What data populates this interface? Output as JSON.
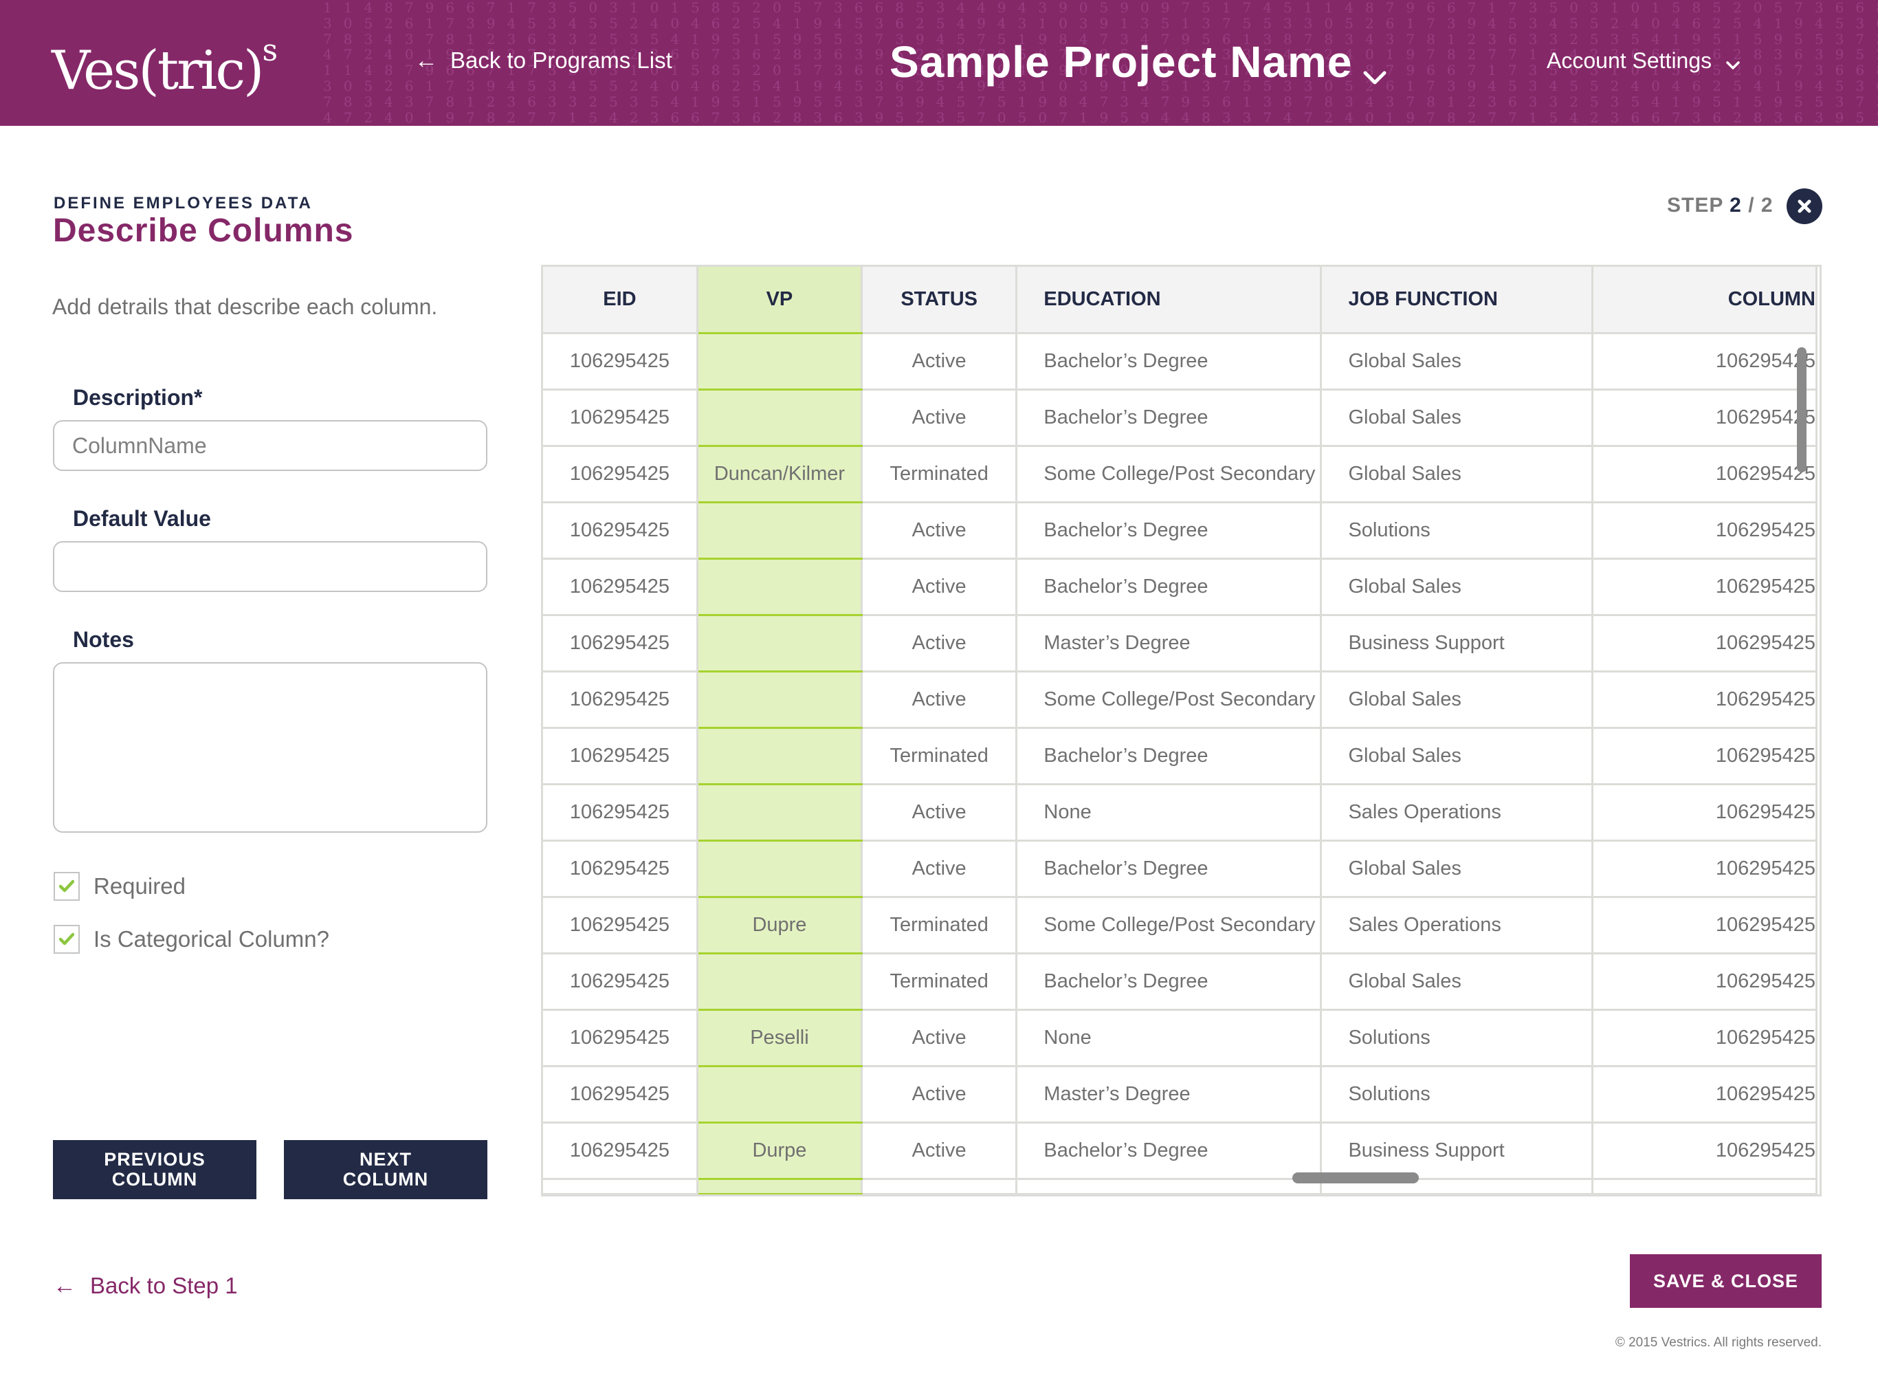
{
  "header": {
    "logo": {
      "main": "Ves(tric)",
      "sup": "s"
    },
    "back_link": {
      "icon": "arrow-left-icon",
      "label": "Back to Programs List"
    },
    "project_name": "Sample Project Name",
    "project_menu_icon": "chevron-down-icon",
    "account_settings": "Account Settings",
    "account_menu_icon": "chevron-down-icon",
    "background_digits": [
      "1 1 4 8 7 9 6 6 7 1 7 3 5 0 3 1 0 1 5 8 5 2 0 5 7 3 6 6 8 5 3 4 4 9 4 3 9 0 5 9 0 9 7 5 1 7 4 5 1 1 4 8 7 9 6 6 7 1 7 3 5 0 3 1 0 1 5 8 5 2 0 5 7 3 6 6 8 5 3 4 4 9 4 3 9",
      "3 0 5 2 6 1 7 3 9 4 5 3 4 5 5 2 4 0 4 6 2 5 4 1 9 4 5 3 6 2 5 4 9 4 3 1 0 3 9 1 3 5 1 3 7 5 5 3 3 0 5 2 6 1 7 3 9 4 5 3 4 5 5 2 4 0 4 6 2 5 4 1 9 4 5 3 6 2 5 4 9 4 3 1 0",
      "7 8 3 4 3 7 8 1 2 3 6 3 3 2 5 3 5 4 1 9 5 1 5 9 5 5 3 7 3 9 4 5 7 5 1 9 8 4 7 3 4 7 9 5 6 1 3 8 7 8 3 4 3 7 8 1 2 3 6 3 3 2 5 3 5 4 1 9 5 1 5 9 5 5 3 7 3 9 4 5 7 5 1 9 8",
      "4 7 2 4 0 1 9 7 8 2 7 7 1 5 4 2 3 6 6 7 3 6 2 8 3 6 3 9 5 2 3 5 7 0 5 0 7 1 9 5 9 4 4 8 3 3 7 4 7 2 4 0 1 9 7 8 2 7 7 1 5 4 2 3 6 6 7 3 6 2 8 3 6 3 9 5 2 3 5 7 0 5 0 7 1",
      "1 1 4 8 7 9 6 6 7 1 7 3 5 0 3 1 0 1 5 8 5 2 0 5 7 3 6 6 8 5 3 4 4 9 4 3 9 0 5 9 0 9 7 5 1 7 4 5 1 1 4 8 7 9 6 6 7 1 7 3 5 0 3 1 0 1 5 8 5 2 0 5 7 3 6 6 8 5 3 4 4 9 4 3 9",
      "3 0 5 2 6 1 7 3 9 4 5 3 4 5 5 2 4 0 4 6 2 5 4 1 9 4 5 3 6 2 5 4 9 4 3 1 0 3 9 1 3 5 1 3 7 5 5 3 3 0 5 2 6 1 7 3 9 4 5 3 4 5 5 2 4 0 4 6 2 5 4 1 9 4 5 3 6 2 5 4 9 4 3 1 0",
      "7 8 3 4 3 7 8 1 2 3 6 3 3 2 5 3 5 4 1 9 5 1 5 9 5 5 3 7 3 9 4 5 7 5 1 9 8 4 7 3 4 7 9 5 6 1 3 8 7 8 3 4 3 7 8 1 2 3 6 3 3 2 5 3 5 4 1 9 5 1 5 9 5 5 3 7 3 9 4 5 7 5 1 9 8",
      "4 7 2 4 0 1 9 7 8 2 7 7 1 5 4 2 3 6 6 7 3 6 2 8 3 6 3 9 5 2 3 5 7 0 5 0 7 1 9 5 9 4 4 8 3 3 7 4 7 2 4 0 1 9 7 8 2 7 7 1 5 4 2 3 6 6 7 3 6 2 8 3 6 3 9 5 2 3 5 7 0 5 0 7 1"
    ]
  },
  "page": {
    "eyebrow": "DEFINE EMPLOYEES DATA",
    "title": "Describe Columns",
    "intro": "Add detrails that describe each column.",
    "step": {
      "label": "STEP",
      "current": "2",
      "separator": "/",
      "total": "2"
    },
    "close_icon": "close-icon"
  },
  "form": {
    "description": {
      "label": "Description*",
      "placeholder": "ColumnName",
      "value": ""
    },
    "default_value": {
      "label": "Default Value",
      "placeholder": "",
      "value": ""
    },
    "notes": {
      "label": "Notes",
      "placeholder": "",
      "value": ""
    },
    "checkboxes": [
      {
        "label": "Required",
        "checked": true
      },
      {
        "label": "Is Categorical Column?",
        "checked": true
      }
    ],
    "previous_button": {
      "line1": "PREVIOUS",
      "line2": "COLUMN"
    },
    "next_button": {
      "line1": "NEXT",
      "line2": "COLUMN"
    },
    "back_step": {
      "icon": "arrow-left-icon",
      "label": "Back to Step 1"
    }
  },
  "table": {
    "highlighted_column": "VP",
    "columns": [
      "EID",
      "VP",
      "STATUS",
      "EDUCATION",
      "JOB FUNCTION",
      "COLUMN"
    ],
    "rows": [
      [
        "106295425",
        "",
        "Active",
        "Bachelor’s Degree",
        "Global Sales",
        "106295425"
      ],
      [
        "106295425",
        "",
        "Active",
        "Bachelor’s Degree",
        "Global Sales",
        "106295425"
      ],
      [
        "106295425",
        "Duncan/Kilmer",
        "Terminated",
        "Some College/Post Secondary",
        "Global Sales",
        "106295425"
      ],
      [
        "106295425",
        "",
        "Active",
        "Bachelor’s Degree",
        "Solutions",
        "106295425"
      ],
      [
        "106295425",
        "",
        "Active",
        "Bachelor’s Degree",
        "Global Sales",
        "106295425"
      ],
      [
        "106295425",
        "",
        "Active",
        "Master’s Degree",
        "Business Support",
        "106295425"
      ],
      [
        "106295425",
        "",
        "Active",
        "Some College/Post Secondary",
        "Global Sales",
        "106295425"
      ],
      [
        "106295425",
        "",
        "Terminated",
        "Bachelor’s Degree",
        "Global Sales",
        "106295425"
      ],
      [
        "106295425",
        "",
        "Active",
        "None",
        "Sales Operations",
        "106295425"
      ],
      [
        "106295425",
        "",
        "Active",
        "Bachelor’s Degree",
        "Global Sales",
        "106295425"
      ],
      [
        "106295425",
        "Dupre",
        "Terminated",
        "Some College/Post Secondary",
        "Sales Operations",
        "106295425"
      ],
      [
        "106295425",
        "",
        "Terminated",
        "Bachelor’s Degree",
        "Global Sales",
        "106295425"
      ],
      [
        "106295425",
        "Peselli",
        "Active",
        "None",
        "Solutions",
        "106295425"
      ],
      [
        "106295425",
        "",
        "Active",
        "Master’s Degree",
        "Solutions",
        "106295425"
      ],
      [
        "106295425",
        "Durpe",
        "Active",
        "Bachelor’s Degree",
        "Business Support",
        "106295425"
      ]
    ]
  },
  "footer": {
    "save_button": "SAVE & CLOSE",
    "copyright": "© 2015 Vestrics. All rights reserved."
  },
  "colors": {
    "brand_purple": "#852868",
    "navy": "#222a45",
    "highlight_green_bg": "#e3f2c1",
    "highlight_green_border": "#a6d32f",
    "check_green": "#8cc63f"
  }
}
